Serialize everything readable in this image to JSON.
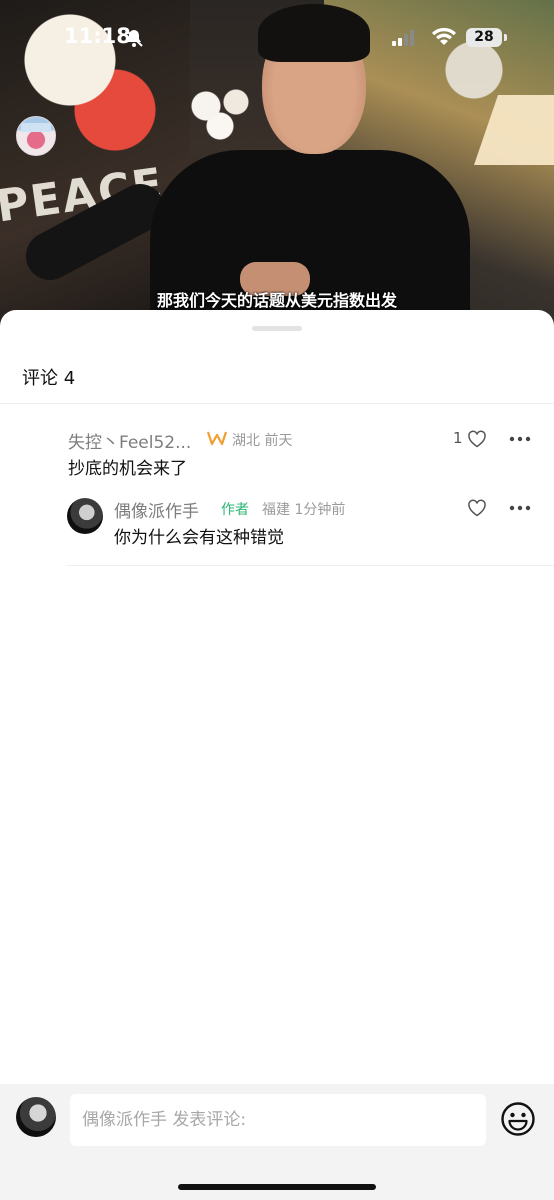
{
  "status_bar": {
    "time": "11:18",
    "battery": "28"
  },
  "video": {
    "subtitle": "那我们今天的话题从美元指数出发",
    "wall_text": "PEACE"
  },
  "comments_sheet": {
    "title": "评论 4",
    "comments": [
      {
        "user": "失控丶Feel52...",
        "location": "湖北",
        "time": "前天",
        "text": "抄底的机会来了",
        "likes": "1",
        "badge_icon": "vip-badge-icon"
      }
    ],
    "reply": {
      "user": "偶像派作手",
      "author_tag": "作者",
      "location": "福建",
      "time": "1分钟前",
      "text": "你为什么会有这种错觉"
    }
  },
  "input_bar": {
    "placeholder": "偶像派作手 发表评论:",
    "emoji_icon": "emoji-icon"
  },
  "colors": {
    "author_tag": "#2bb673",
    "vip_badge": "#f0a030",
    "muted": "#9a9a9a"
  }
}
